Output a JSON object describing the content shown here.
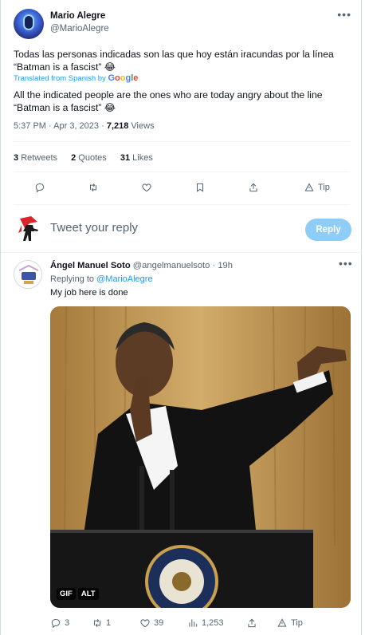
{
  "main_tweet": {
    "author_name": "Mario Alegre",
    "author_handle": "@MarioAlegre",
    "text_original": "Todas las personas indicadas son las que hoy están iracundas por la línea “Batman is a fascist” 😂",
    "translated_label": "Translated from Spanish by",
    "translator": "Google",
    "text_translated": "All the indicated people are the ones who are today angry about the line “Batman is a fascist” 😂",
    "time": "5:37 PM",
    "date": "Apr 3, 2023",
    "views_count": "7,218",
    "views_label": "Views",
    "stats": {
      "retweets_count": "3",
      "retweets_label": "Retweets",
      "quotes_count": "2",
      "quotes_label": "Quotes",
      "likes_count": "31",
      "likes_label": "Likes"
    },
    "tip_label": "Tip"
  },
  "reply_box": {
    "placeholder": "Tweet your reply",
    "button_label": "Reply"
  },
  "reply_tweet": {
    "author_name": "Ángel Manuel Soto",
    "author_handle": "@angelmanuelsoto",
    "separator": "·",
    "age": "19h",
    "replying_label": "Replying to",
    "replying_to": "@MarioAlegre",
    "text": "My job here is done",
    "media_badges": [
      "GIF",
      "ALT"
    ],
    "actions": {
      "replies": "3",
      "retweets": "1",
      "likes": "39",
      "views": "1,253",
      "tip_label": "Tip"
    }
  },
  "icons": [
    "more-icon",
    "reply-icon",
    "retweet-icon",
    "like-icon",
    "bookmark-icon",
    "share-icon",
    "tip-icon",
    "views-icon"
  ],
  "colors": {
    "accent": "#1d9bf0",
    "reply_button_disabled": "#8ecdf8",
    "secondary_text": "#536471",
    "divider": "#eff3f4"
  }
}
